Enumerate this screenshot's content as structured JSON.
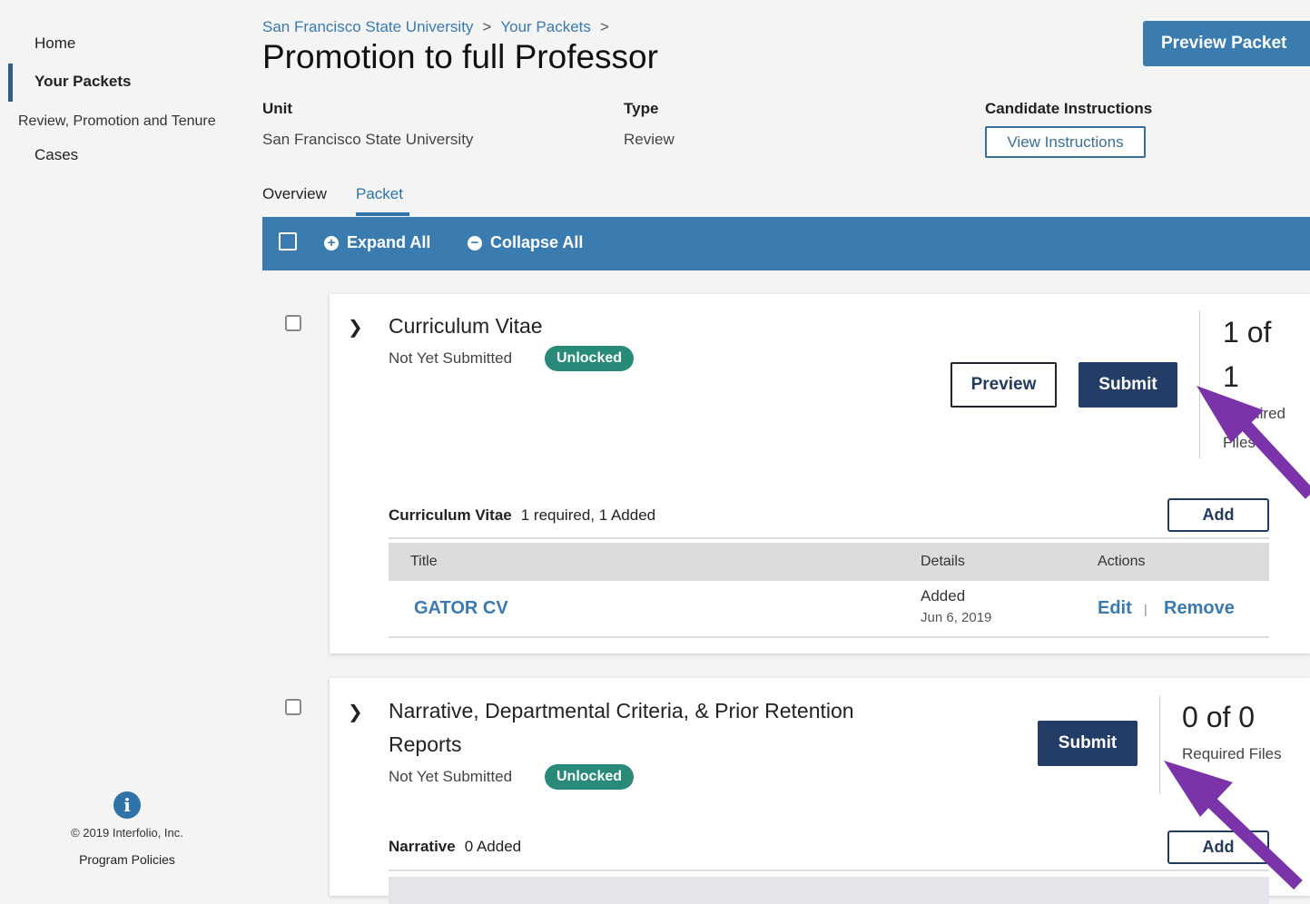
{
  "sidebar": {
    "home": "Home",
    "your_packets": "Your Packets",
    "section": "Review, Promotion and Tenure",
    "cases": "Cases"
  },
  "footer": {
    "copyright": "© 2019 Interfolio, Inc.",
    "policies": "Program Policies"
  },
  "breadcrumb": [
    "San Francisco State University",
    "Your Packets"
  ],
  "page_title": "Promotion to full Professor",
  "preview_packet": "Preview Packet",
  "meta": {
    "unit_label": "Unit",
    "unit_value": "San Francisco State University",
    "type_label": "Type",
    "type_value": "Review",
    "instructions_label": "Candidate Instructions",
    "instructions_button": "View Instructions"
  },
  "tabs": [
    "Overview",
    "Packet"
  ],
  "toolbar": {
    "expand": "Expand All",
    "collapse": "Collapse All"
  },
  "section1": {
    "title": "Curriculum Vitae",
    "status": "Not Yet Submitted",
    "badge": "Unlocked",
    "preview": "Preview",
    "submit": "Submit",
    "count": "1 of",
    "count2": "1",
    "count_sub": "Required",
    "count_sub2": "Files",
    "list_label": "Curriculum Vitae",
    "list_info": "1 required, 1 Added",
    "add": "Add",
    "columns": [
      "Title",
      "Details",
      "Actions"
    ],
    "rows": [
      {
        "title": "GATOR CV",
        "detail": "Added",
        "date": "Jun 6, 2019",
        "edit": "Edit",
        "sep": "|",
        "remove": "Remove"
      }
    ]
  },
  "section2": {
    "title_line1": "Narrative, Departmental Criteria, & Prior Retention",
    "title_line2": "Reports",
    "status": "Not Yet Submitted",
    "badge": "Unlocked",
    "submit": "Submit",
    "count": "0 of 0",
    "count_sub": "Required Files",
    "list_label": "Narrative",
    "list_info": "0 Added",
    "add": "Add"
  },
  "colors": {
    "primary": "#3b7cb0",
    "dark_button": "#233d66",
    "badge": "#2a8a7a",
    "arrow": "#7a33a8"
  }
}
